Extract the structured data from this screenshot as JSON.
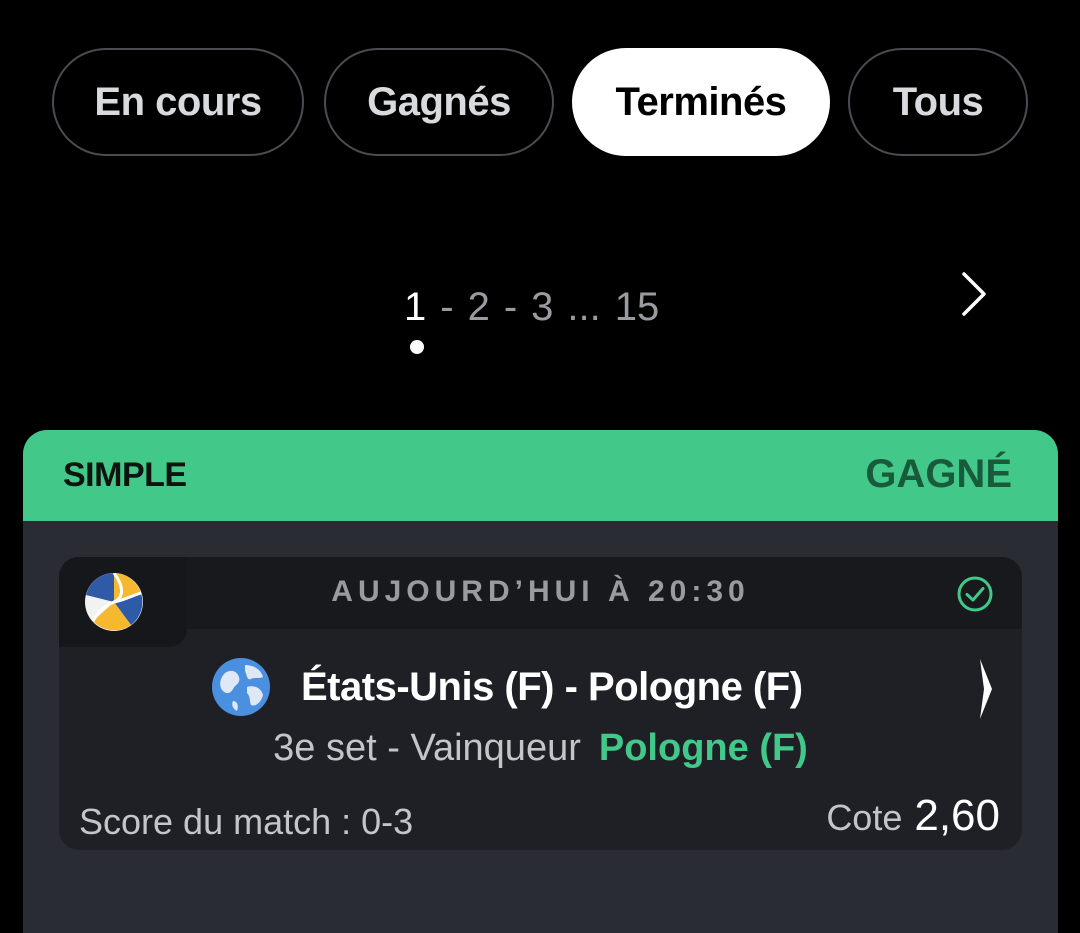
{
  "filters": {
    "tabs": [
      {
        "label": "En cours",
        "active": false
      },
      {
        "label": "Gagnés",
        "active": false
      },
      {
        "label": "Terminés",
        "active": true
      },
      {
        "label": "Tous",
        "active": false
      }
    ]
  },
  "pagination": {
    "current": "1",
    "pages": [
      "1",
      "2",
      "3"
    ],
    "separator": "-",
    "ellipsis": "...",
    "last": "15",
    "next_icon": "chevron-right-icon"
  },
  "bet": {
    "type": "SIMPLE",
    "status": "GAGNÉ",
    "selection": {
      "sport_icon": "volleyball-icon",
      "datetime": "AUJOURD’HUI À 20:30",
      "status_icon": "check-circle-icon",
      "region_icon": "globe-icon",
      "event": "États-Unis (F) - Pologne (F)",
      "market": "3e set - Vainqueur",
      "pick": "Pologne (F)",
      "score": "Score du match : 0-3",
      "odds_label": "Cote",
      "odds": "2,60"
    }
  },
  "colors": {
    "background": "#000000",
    "accent_green": "#42c98a",
    "card": "#2a2c33",
    "inner_card": "#1e2026",
    "status_dark_green": "#1a5a3c"
  }
}
